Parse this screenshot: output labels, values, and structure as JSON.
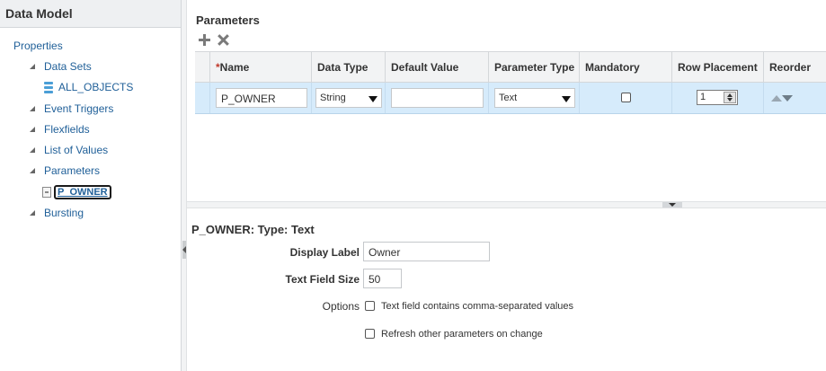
{
  "left_panel": {
    "title": "Data Model",
    "root": "Properties",
    "items": [
      {
        "label": "Data Sets",
        "children": [
          {
            "label": "ALL_OBJECTS",
            "icon": "database-icon"
          }
        ]
      },
      {
        "label": "Event Triggers"
      },
      {
        "label": "Flexfields"
      },
      {
        "label": "List of Values"
      },
      {
        "label": "Parameters",
        "children": [
          {
            "label": "P_OWNER",
            "icon": "parameter-icon",
            "selected": true
          }
        ]
      },
      {
        "label": "Bursting"
      }
    ]
  },
  "parameters": {
    "title": "Parameters",
    "toolbar": {
      "add_icon": "plus-icon",
      "delete_icon": "close-icon"
    },
    "columns": {
      "name_required_mark": "*",
      "name": "Name",
      "data_type": "Data Type",
      "default_value": "Default Value",
      "parameter_type": "Parameter Type",
      "mandatory": "Mandatory",
      "row_placement": "Row Placement",
      "reorder": "Reorder"
    },
    "rows": [
      {
        "name": "P_OWNER",
        "data_type": "String",
        "default_value": "",
        "parameter_type": "Text",
        "mandatory": false,
        "row_placement": "1"
      }
    ]
  },
  "detail": {
    "title": "P_OWNER: Type: Text",
    "display_label_label": "Display Label",
    "display_label_value": "Owner",
    "text_field_size_label": "Text Field Size",
    "text_field_size_value": "50",
    "options_label": "Options",
    "option_comma": "Text field contains comma-separated values",
    "option_comma_checked": false,
    "option_refresh": "Refresh other parameters on change",
    "option_refresh_checked": false
  },
  "colors": {
    "selected_row": "#d6ebfb",
    "link": "#1f5f98",
    "header_bg": "#f2f3f4"
  }
}
